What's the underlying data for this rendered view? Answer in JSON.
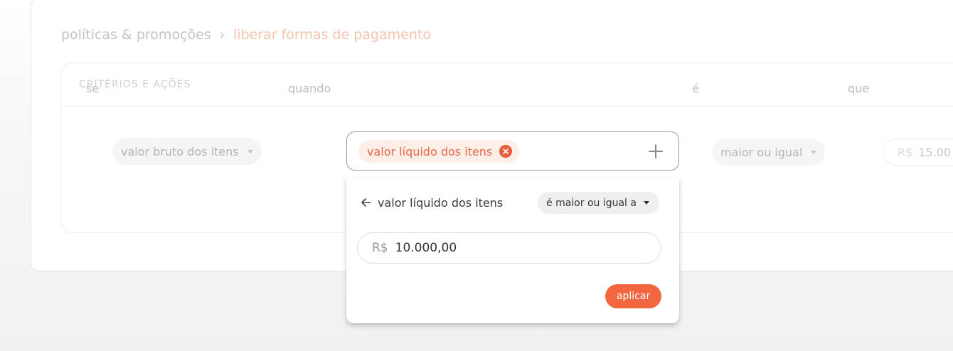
{
  "breadcrumb": {
    "parent": "políticas & promoções",
    "separator": "›",
    "current": "liberar formas de pagamento"
  },
  "section": {
    "title": "CRITÉRIOS E AÇÕES"
  },
  "rule": {
    "word_if": "se",
    "field_select": "valor bruto dos itens",
    "word_when": "quando",
    "selected_chip": "valor líquido dos itens",
    "word_is": "é",
    "operator_select": "maior ou igual",
    "word_than": "que",
    "value_currency": "R$",
    "value_amount": "15.00"
  },
  "popover": {
    "back_label": "valor líquido dos itens",
    "operator": "é maior ou igual a",
    "currency": "R$",
    "amount": "10.000,00",
    "apply_label": "aplicar"
  },
  "colors": {
    "accent": "#f26640",
    "chip_bg": "#fdeee8",
    "chip_text": "#e8694a"
  }
}
